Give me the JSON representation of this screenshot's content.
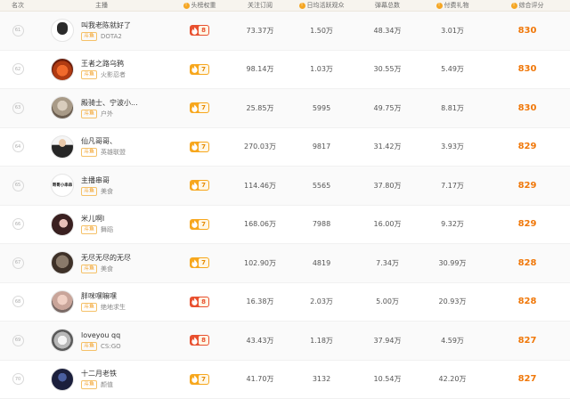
{
  "header": {
    "rank": "名次",
    "anchor": "主播",
    "weight": "头榜权重",
    "follow": "关注订阅",
    "active": "日均活跃观众",
    "danmu": "弹幕总数",
    "gift": "付费礼物",
    "score": "综合评分",
    "info_icon": "!"
  },
  "rows": [
    {
      "rank": "61",
      "name": "叫我老陈就好了",
      "tag": "斗鱼",
      "cat": "DOTA2",
      "weight": "8",
      "weight_color": "red",
      "follow": "73.37万",
      "active": "1.50万",
      "danmu": "48.34万",
      "gift": "3.01万",
      "score": "830"
    },
    {
      "rank": "62",
      "name": "王者之路乌鸦",
      "tag": "斗鱼",
      "cat": "火影忍者",
      "weight": "7",
      "weight_color": "orange",
      "follow": "98.14万",
      "active": "1.03万",
      "danmu": "30.55万",
      "gift": "5.49万",
      "score": "830"
    },
    {
      "rank": "63",
      "name": "殿骑士、宁波小...",
      "tag": "斗鱼",
      "cat": "户外",
      "weight": "7",
      "weight_color": "orange",
      "follow": "25.85万",
      "active": "5995",
      "danmu": "49.75万",
      "gift": "8.81万",
      "score": "830"
    },
    {
      "rank": "64",
      "name": "仙凡哥哥、",
      "tag": "斗鱼",
      "cat": "英雄联盟",
      "weight": "7",
      "weight_color": "orange",
      "follow": "270.03万",
      "active": "9817",
      "danmu": "31.42万",
      "gift": "3.93万",
      "score": "829"
    },
    {
      "rank": "65",
      "name": "主播串哥",
      "tag": "斗鱼",
      "cat": "美食",
      "weight": "7",
      "weight_color": "orange",
      "follow": "114.46万",
      "active": "5565",
      "danmu": "37.80万",
      "gift": "7.17万",
      "score": "829",
      "avatar_text": "哥哥小串串"
    },
    {
      "rank": "66",
      "name": "米儿啊l",
      "tag": "斗鱼",
      "cat": "舞蹈",
      "weight": "7",
      "weight_color": "orange",
      "follow": "168.06万",
      "active": "7988",
      "danmu": "16.00万",
      "gift": "9.32万",
      "score": "829"
    },
    {
      "rank": "67",
      "name": "无尽无尽的无尽",
      "tag": "斗鱼",
      "cat": "美食",
      "weight": "7",
      "weight_color": "orange",
      "follow": "102.90万",
      "active": "4819",
      "danmu": "7.34万",
      "gift": "30.99万",
      "score": "828"
    },
    {
      "rank": "68",
      "name": "胖咪嘿嘛嘿",
      "tag": "斗鱼",
      "cat": "绝地求生",
      "weight": "8",
      "weight_color": "red",
      "follow": "16.38万",
      "active": "2.03万",
      "danmu": "5.00万",
      "gift": "20.93万",
      "score": "828"
    },
    {
      "rank": "69",
      "name": "loveyou qq",
      "tag": "斗鱼",
      "cat": "CS:GO",
      "weight": "8",
      "weight_color": "red",
      "follow": "43.43万",
      "active": "1.18万",
      "danmu": "37.94万",
      "gift": "4.59万",
      "score": "827"
    },
    {
      "rank": "70",
      "name": "十二月老铁",
      "tag": "斗鱼",
      "cat": "颜值",
      "weight": "7",
      "weight_color": "orange",
      "follow": "41.70万",
      "active": "3132",
      "danmu": "10.54万",
      "gift": "42.20万",
      "score": "827"
    }
  ]
}
